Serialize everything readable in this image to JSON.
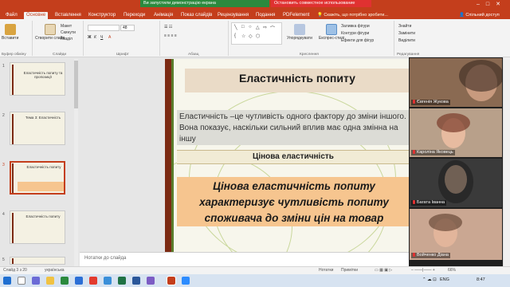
{
  "window": {
    "file_tab": "Файл",
    "tabs": [
      "Основне",
      "Вставлення",
      "Конструктор",
      "Переходи",
      "Анімація",
      "Показ слайдів",
      "Рецензування",
      "Подання",
      "PDFelement"
    ],
    "active_tab": "Основне",
    "sharing_banner": "Ви запустили демонстрацію екрана",
    "stop_sharing": "Остановить совместное использование",
    "search_placeholder": "Скажіть, що потрібно зробити...",
    "share_button": "Спільний доступ"
  },
  "ribbon": {
    "clipboard": {
      "paste": "Вставити",
      "label": "Буфер обміну"
    },
    "slides": {
      "new_slide": "Створити слайд",
      "layout": "Макет",
      "reset": "Скинути",
      "section": "Розділ",
      "label": "Слайди"
    },
    "font": {
      "size": "48",
      "label": "Шрифт"
    },
    "paragraph": {
      "label": "Абзац"
    },
    "drawing": {
      "arrange": "Упорядкувати",
      "quick_styles": "Експрес-стилі",
      "fill": "Заливка фігури",
      "outline": "Контури фігури",
      "effects": "Ефекти для фігур",
      "label": "Креслення"
    },
    "editing": {
      "find": "Знайти",
      "replace": "Замінити",
      "select": "Виділити",
      "label": "Редагування"
    }
  },
  "slides_panel": [
    {
      "num": "1",
      "title": "Еластичність попиту та пропозиції"
    },
    {
      "num": "2",
      "title": "Тема 3: Еластичність"
    },
    {
      "num": "3",
      "title": "Еластичність попиту"
    },
    {
      "num": "4",
      "title": "Еластичність попиту"
    },
    {
      "num": "5",
      "title": ""
    }
  ],
  "selected_slide": "3",
  "slide": {
    "title": "Еластичність попиту",
    "body": "Еластичність –це чутливість одного фактору до зміни іншого. Вона показує, наскільки сильний вплив має одна змінна на іншу",
    "subtitle": "Цінова еластичність",
    "highlight": "Цінова еластичність попиту характеризує чутливість попиту споживача до зміни цін на товар"
  },
  "participants": [
    {
      "name": "Євгенія Жукова"
    },
    {
      "name": "Кароліна Яковець"
    },
    {
      "name": "Багата Іванна"
    },
    {
      "name": "Войченко Діана"
    }
  ],
  "notes_placeholder": "Нотатки до слайда",
  "status": {
    "slide_counter": "Слайд 3 з 20",
    "language": "українська",
    "notes": "Нотатки",
    "comments": "Примітки",
    "zoom": "66%"
  },
  "taskbar": {
    "language": "ENG",
    "time": "8:47"
  },
  "colors": {
    "accent": "#c43e1c",
    "slide_bar": "#7c2a13",
    "highlight": "#f6c58f",
    "sharing_green": "#2b8a3e",
    "stop_red": "#e03131"
  }
}
